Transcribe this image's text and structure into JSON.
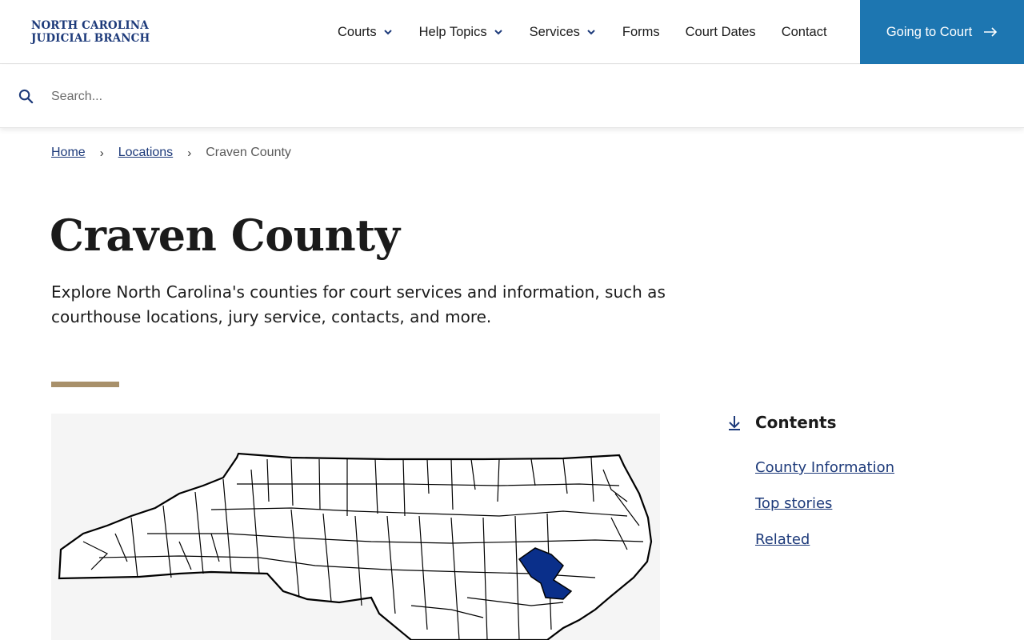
{
  "brand": {
    "line1": "NORTH CAROLINA",
    "line2": "JUDICIAL BRANCH",
    "color": "#1d3a7a"
  },
  "nav": {
    "items": [
      {
        "label": "Courts",
        "has_dropdown": true
      },
      {
        "label": "Help Topics",
        "has_dropdown": true
      },
      {
        "label": "Services",
        "has_dropdown": true
      },
      {
        "label": "Forms",
        "has_dropdown": false
      },
      {
        "label": "Court Dates",
        "has_dropdown": false
      },
      {
        "label": "Contact",
        "has_dropdown": false
      }
    ],
    "cta_label": "Going to Court",
    "cta_color": "#1d76b1"
  },
  "search": {
    "placeholder": "Search..."
  },
  "breadcrumb": {
    "home": "Home",
    "locations": "Locations",
    "current": "Craven County"
  },
  "page": {
    "title": "Craven County",
    "intro": "Explore North Carolina's counties for court services and information, such as courthouse locations, jury service, contacts, and more.",
    "accent_color": "#a8906a"
  },
  "map": {
    "highlight_color": "#0a2f8a",
    "icon": "north-carolina-county-map"
  },
  "contents": {
    "title": "Contents",
    "items": [
      {
        "label": "County Information"
      },
      {
        "label": "Top stories"
      },
      {
        "label": "Related"
      }
    ]
  }
}
